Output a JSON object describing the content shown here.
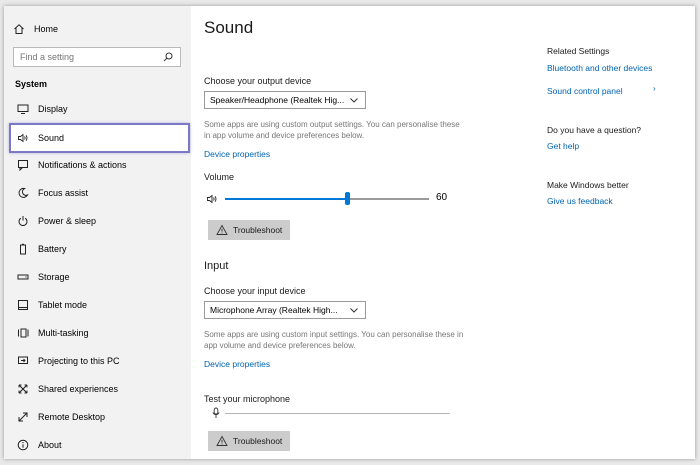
{
  "sidebar": {
    "home_label": "Home",
    "search_placeholder": "Find a setting",
    "section_label": "System",
    "items": [
      {
        "label": "Display",
        "icon": "display-icon"
      },
      {
        "label": "Sound",
        "icon": "speaker-icon",
        "selected": true
      },
      {
        "label": "Notifications & actions",
        "icon": "notification-icon"
      },
      {
        "label": "Focus assist",
        "icon": "moon-icon"
      },
      {
        "label": "Power & sleep",
        "icon": "power-icon"
      },
      {
        "label": "Battery",
        "icon": "battery-icon"
      },
      {
        "label": "Storage",
        "icon": "storage-icon"
      },
      {
        "label": "Tablet mode",
        "icon": "tablet-icon"
      },
      {
        "label": "Multi-tasking",
        "icon": "multitasking-icon"
      },
      {
        "label": "Projecting to this PC",
        "icon": "projecting-icon"
      },
      {
        "label": "Shared experiences",
        "icon": "shared-icon"
      },
      {
        "label": "Remote Desktop",
        "icon": "remote-icon"
      },
      {
        "label": "About",
        "icon": "info-icon"
      }
    ]
  },
  "main": {
    "title": "Sound",
    "output": {
      "choose_label": "Choose your output device",
      "device": "Speaker/Headphone (Realtek Hig...",
      "description": "Some apps are using custom output settings. You can personalise these in app volume and device preferences below.",
      "properties_link": "Device properties",
      "volume_label": "Volume",
      "volume_value": "60",
      "volume_level": 0.6,
      "troubleshoot_label": "Troubleshoot"
    },
    "input": {
      "heading": "Input",
      "choose_label": "Choose your input device",
      "device": "Microphone Array (Realtek High...",
      "description": "Some apps are using custom input settings. You can personalise these in app volume and device preferences below.",
      "properties_link": "Device properties",
      "test_label": "Test your microphone",
      "mic_level": 0,
      "troubleshoot_label": "Troubleshoot"
    }
  },
  "related": {
    "title": "Related Settings",
    "bluetooth_link": "Bluetooth and other devices",
    "control_panel_link": "Sound control panel",
    "question_title": "Do you have a question?",
    "help_link": "Get help",
    "better_title": "Make Windows better",
    "feedback_link": "Give us feedback"
  },
  "colors": {
    "accent": "#0078d7",
    "link": "#0063b1",
    "selection_border": "#7b79c6"
  }
}
